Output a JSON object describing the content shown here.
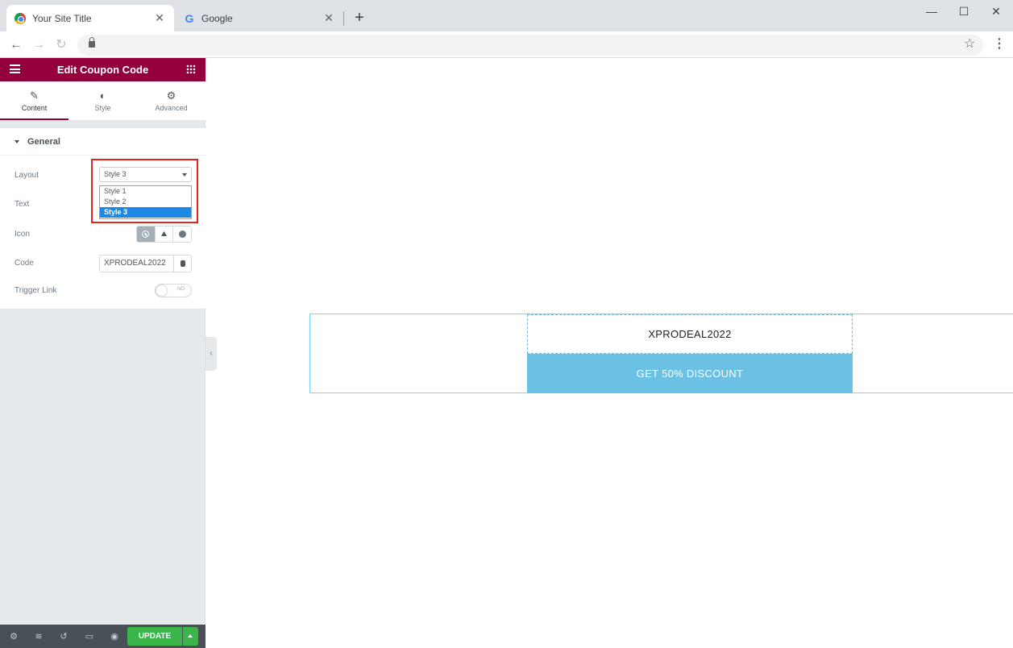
{
  "browser": {
    "tabs": [
      {
        "title": "Your Site Title",
        "favicon": "chrome-icon",
        "active": true
      },
      {
        "title": "Google",
        "favicon": "google-icon",
        "active": false
      }
    ],
    "new_tab_label": "+",
    "close_glyph": "✕",
    "window_controls": {
      "minimize": "—",
      "maximize": "☐",
      "close": "✕"
    }
  },
  "panel": {
    "title": "Edit Coupon Code",
    "accent_color": "#93003c",
    "tabs": [
      {
        "label": "Content",
        "icon": "pencil-icon",
        "active": true
      },
      {
        "label": "Style",
        "icon": "contrast-icon",
        "active": false
      },
      {
        "label": "Advanced",
        "icon": "gear-icon",
        "active": false
      }
    ],
    "section": {
      "title": "General",
      "controls": {
        "layout": {
          "label": "Layout",
          "value": "Style 3",
          "options": [
            "Style 1",
            "Style 2",
            "Style 3"
          ],
          "selected_index": 2
        },
        "text": {
          "label": "Text"
        },
        "icon": {
          "label": "Icon",
          "choices": [
            "none-icon",
            "upload-icon",
            "circle-icon"
          ],
          "active": "none-icon"
        },
        "code": {
          "label": "Code",
          "value": "XPRODEAL2022"
        },
        "trigger_link": {
          "label": "Trigger Link",
          "state_text": "NO",
          "on": false
        }
      }
    },
    "footer": {
      "icons": [
        "settings-icon",
        "layers-icon",
        "history-icon",
        "responsive-icon",
        "preview-icon"
      ],
      "update_label": "UPDATE",
      "update_color": "#39b54a"
    }
  },
  "canvas": {
    "coupon_code": "XPRODEAL2022",
    "button_text": "GET 50% DISCOUNT",
    "button_color": "#6ac1e3"
  }
}
